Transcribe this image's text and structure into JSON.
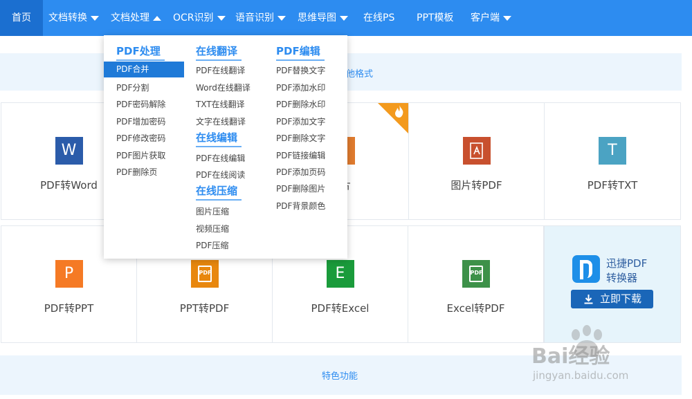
{
  "nav": {
    "items": [
      {
        "label": "首页",
        "caret": false
      },
      {
        "label": "文档转换",
        "caret": true
      },
      {
        "label": "文档处理",
        "caret": true
      },
      {
        "label": "OCR识别",
        "caret": true
      },
      {
        "label": "语音识别",
        "caret": true
      },
      {
        "label": "思维导图",
        "caret": true
      },
      {
        "label": "在线PS",
        "caret": false
      },
      {
        "label": "PPT模板",
        "caret": false
      },
      {
        "label": "客户端",
        "caret": true
      }
    ]
  },
  "banner": {
    "partial_text": "他格式"
  },
  "tiles_row1": [
    {
      "label": "PDF转Word",
      "icon": "word-icon",
      "color": "#2b5caa",
      "glyph": "W"
    },
    {
      "label": "图片",
      "icon": "image-icon",
      "color": "#e07b2e",
      "glyph": ""
    },
    {
      "label": "图片转PDF",
      "icon": "pdf-icon",
      "color": "#c8502e",
      "glyph": "A"
    },
    {
      "label": "PDF转TXT",
      "icon": "txt-icon",
      "color": "#4ba3c3",
      "glyph": "T"
    }
  ],
  "tiles_row2": [
    {
      "label": "PDF转PPT",
      "icon": "ppt-icon",
      "color": "#f57a25",
      "glyph": "P"
    },
    {
      "label": "PPT转PDF",
      "icon": "pdf-doc-icon",
      "color": "#e8870e",
      "glyph": "PDF"
    },
    {
      "label": "PDF转Excel",
      "icon": "excel-icon",
      "color": "#1a9b3b",
      "glyph": "E"
    },
    {
      "label": "Excel转PDF",
      "icon": "pdf-doc-icon",
      "color": "#3d9149",
      "glyph": "PDF"
    }
  ],
  "download": {
    "line1": "迅捷PDF",
    "line2": "转换器",
    "button": "立即下载",
    "logo_color": "#1e8fe8",
    "button_color": "#1a66b8"
  },
  "feature_strip": {
    "label": "特色功能"
  },
  "dropdown": {
    "columns": [
      {
        "heading": "PDF处理",
        "items": [
          "PDF合并",
          "PDF分割",
          "PDF密码解除",
          "PDF增加密码",
          "PDF修改密码",
          "PDF图片获取",
          "PDF删除页"
        ]
      },
      {
        "sections": [
          {
            "heading": "在线翻译",
            "items": [
              "PDF在线翻译",
              "Word在线翻译",
              "TXT在线翻译",
              "文字在线翻译"
            ]
          },
          {
            "heading": "在线编辑",
            "items": [
              "PDF在线编辑",
              "PDF在线阅读"
            ]
          },
          {
            "heading": "在线压缩",
            "items": [
              "图片压缩",
              "视频压缩",
              "PDF压缩"
            ]
          }
        ]
      },
      {
        "heading": "PDF编辑",
        "items": [
          "PDF替换文字",
          "PDF添加水印",
          "PDF删除水印",
          "PDF添加文字",
          "PDF删除文字",
          "PDF链接编辑",
          "PDF添加页码",
          "PDF删除图片",
          "PDF背景颜色"
        ]
      }
    ],
    "selected_item": "PDF合并"
  },
  "watermark": {
    "brand": "Bai经验",
    "url": "jingyan.baidu.com"
  },
  "colors": {
    "nav_bg": "#2d8cf0",
    "nav_active": "#1b6fd0",
    "accent": "#2d8cf0",
    "hot_badge": "#f39a1e"
  }
}
